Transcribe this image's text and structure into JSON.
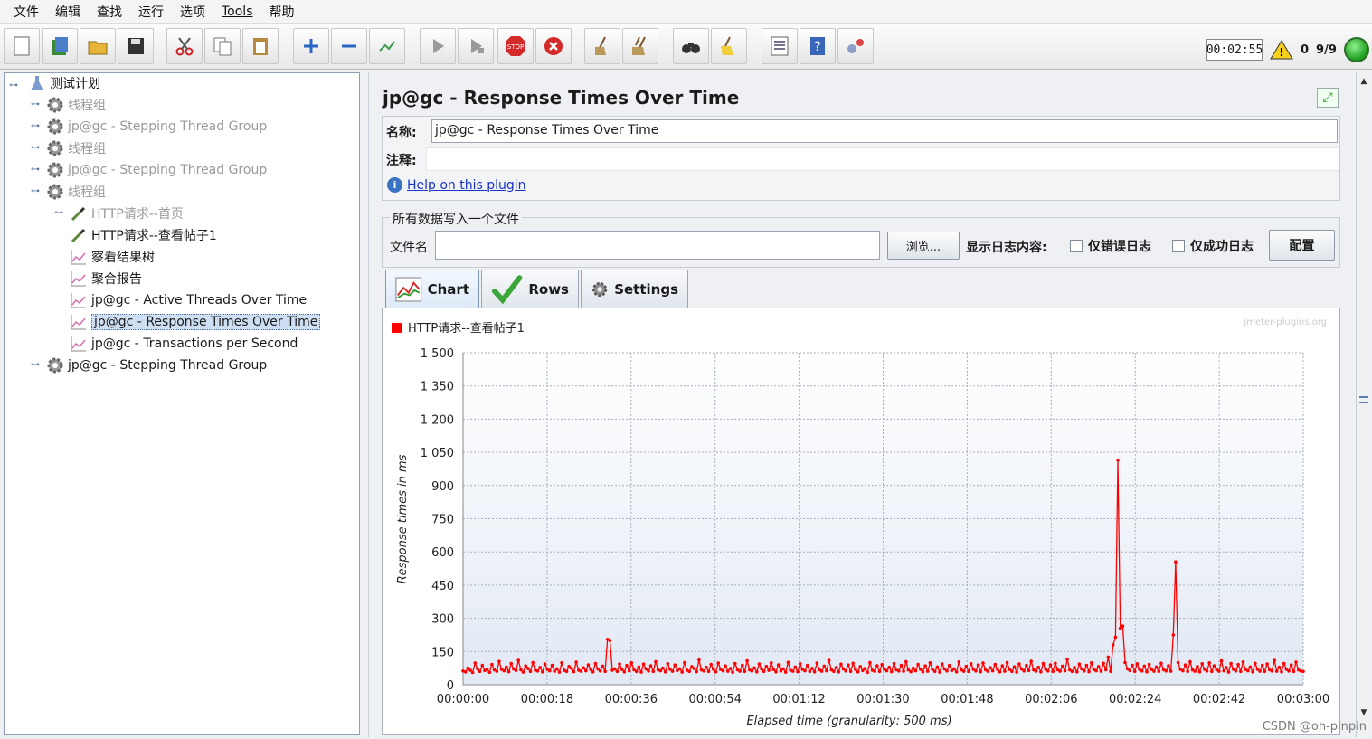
{
  "menu": [
    "文件",
    "编辑",
    "查找",
    "运行",
    "选项",
    "Tools",
    "帮助"
  ],
  "toolbar": {
    "buttons": [
      "new",
      "templates",
      "open",
      "save",
      "cut",
      "copy",
      "paste",
      "expand",
      "collapse",
      "toggle",
      "start",
      "start-no-pause",
      "stop",
      "shutdown",
      "clear",
      "clear-all",
      "search",
      "reset-search",
      "function-helper",
      "help",
      "remote"
    ],
    "timer": "00:02:55",
    "warnings": "0",
    "threads": "9/9"
  },
  "tree": {
    "root": "测试计划",
    "items": [
      {
        "label": "线程组",
        "dim": true
      },
      {
        "label": "jp@gc - Stepping Thread Group",
        "dim": true
      },
      {
        "label": "线程组",
        "dim": true
      },
      {
        "label": "jp@gc - Stepping Thread Group",
        "dim": true
      },
      {
        "label": "线程组",
        "dim": true
      },
      {
        "label": "HTTP请求--首页",
        "dim": true
      },
      {
        "label": "HTTP请求--查看帖子1",
        "dim": false
      },
      {
        "label": "察看结果树",
        "dim": false
      },
      {
        "label": "聚合报告",
        "dim": false
      },
      {
        "label": "jp@gc - Active Threads Over Time",
        "dim": false
      },
      {
        "label": "jp@gc - Response Times Over Time",
        "dim": false,
        "selected": true
      },
      {
        "label": "jp@gc - Transactions per Second",
        "dim": false
      },
      {
        "label": "jp@gc - Stepping Thread Group",
        "dim": false
      }
    ]
  },
  "panel": {
    "title": "jp@gc - Response Times Over Time",
    "name_label": "名称:",
    "name_value": "jp@gc - Response Times Over Time",
    "comment_label": "注释:",
    "help_link": "Help on this plugin",
    "file_section": "所有数据写入一个文件",
    "filename_label": "文件名",
    "browse": "浏览...",
    "log_label": "显示日志内容:",
    "errors_only": "仅错误日志",
    "success_only": "仅成功日志",
    "configure": "配置",
    "tabs": [
      "Chart",
      "Rows",
      "Settings"
    ]
  },
  "chart_data": {
    "type": "line",
    "watermark": "jmeter-plugins.org",
    "legend": "HTTP请求--查看帖子1",
    "legend_position": "top-left",
    "color": "#ff0000",
    "ylabel": "Response times in ms",
    "xlabel": "Elapsed time (granularity: 500 ms)",
    "ylim": [
      0,
      1500
    ],
    "yticks": [
      "0",
      "150",
      "300",
      "450",
      "600",
      "750",
      "900",
      "1 050",
      "1 200",
      "1 350",
      "1 500"
    ],
    "xticks": [
      "00:00:00",
      "00:00:18",
      "00:00:36",
      "00:00:54",
      "00:01:12",
      "00:01:30",
      "00:01:48",
      "00:02:06",
      "00:02:24",
      "00:02:42",
      "00:03:00"
    ],
    "grid": true,
    "series": [
      {
        "values": [
          62,
          58,
          75,
          66,
          55,
          98,
          72,
          60,
          88,
          64,
          70,
          56,
          92,
          67,
          61,
          105,
          70,
          63,
          80,
          59,
          96,
          71,
          64,
          110,
          68,
          57,
          85,
          73,
          60,
          100,
          66,
          62,
          78,
          58,
          94,
          70,
          63,
          88,
          61,
          72,
          57,
          99,
          65,
          60,
          83,
          74,
          59,
          102,
          66,
          61,
          77,
          63,
          90,
          69,
          58,
          96,
          71,
          62,
          84,
          60,
          205,
          200,
          66,
          72,
          60,
          94,
          70,
          58,
          87,
          63,
          99,
          68,
          60,
          80,
          57,
          93,
          71,
          62,
          86,
          60,
          104,
          68,
          63,
          75,
          58,
          95,
          70,
          61,
          89,
          64,
          72,
          57,
          100,
          66,
          60,
          82,
          73,
          59,
          112,
          67,
          62,
          79,
          60,
          92,
          70,
          58,
          98,
          69,
          63,
          85,
          61,
          73,
          56,
          96,
          68,
          61,
          88,
          60,
          108,
          67,
          62,
          76,
          58,
          94,
          71,
          60,
          83,
          65,
          99,
          69,
          58,
          90,
          62,
          72,
          57,
          101,
          66,
          61,
          80,
          59,
          95,
          70,
          63,
          87,
          60,
          74,
          58,
          98,
          68,
          61,
          84,
          63,
          110,
          67,
          60,
          78,
          58,
          93,
          71,
          62,
          89,
          60,
          97,
          69,
          58,
          82,
          64,
          73,
          56,
          100,
          66,
          61,
          86,
          60,
          91,
          70,
          63,
          79,
          59,
          96,
          68,
          62,
          88,
          61,
          104,
          67,
          59,
          75,
          63,
          92,
          70,
          58,
          85,
          61,
          99,
          69,
          60,
          80,
          57,
          94,
          71,
          62,
          87,
          64,
          72,
          58,
          103,
          67,
          61,
          83,
          60,
          95,
          70,
          62,
          89,
          59,
          98,
          68,
          61,
          77,
          63,
          92,
          70,
          58,
          86,
          61,
          100,
          69,
          60,
          81,
          57,
          94,
          71,
          62,
          87,
          64,
          106,
          67,
          61,
          79,
          58,
          96,
          70,
          62,
          90,
          60,
          97,
          68,
          61,
          84,
          63,
          115,
          67,
          60,
          78,
          58,
          93,
          71,
          62,
          88,
          59,
          99,
          69,
          63,
          82,
          61,
          97,
          68,
          125,
          60,
          180,
          215,
          1015,
          255,
          265,
          100,
          72,
          64,
          88,
          60,
          95,
          70,
          62,
          84,
          58,
          92,
          69,
          61,
          80,
          60,
          97,
          68,
          62,
          86,
          61,
          225,
          555,
          100,
          70,
          63,
          89,
          60,
          104,
          67,
          61,
          82,
          58,
          95,
          70,
          62,
          99,
          60,
          86,
          68,
          61,
          108,
          63,
          78,
          57,
          96,
          70,
          62,
          91,
          60,
          103,
          69,
          63,
          80,
          58,
          97,
          70,
          61,
          88,
          60,
          94,
          68,
          62,
          110,
          61,
          79,
          58,
          96,
          70,
          62,
          89,
          60,
          102,
          67,
          62,
          60
        ]
      }
    ]
  }
}
